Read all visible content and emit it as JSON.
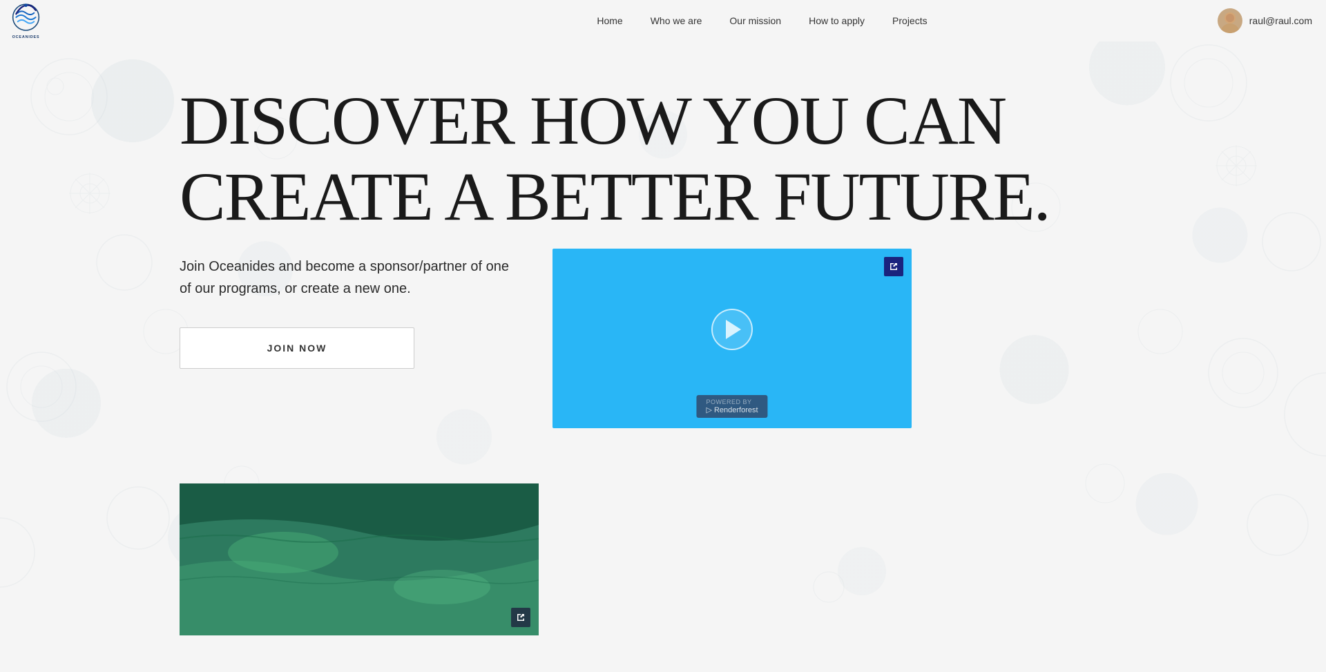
{
  "navbar": {
    "brand_name": "OCEANIDES",
    "links": [
      {
        "id": "home",
        "label": "Home"
      },
      {
        "id": "who-we-are",
        "label": "Who we are"
      },
      {
        "id": "our-mission",
        "label": "Our mission"
      },
      {
        "id": "how-to-apply",
        "label": "How to apply"
      },
      {
        "id": "projects",
        "label": "Projects"
      }
    ],
    "user_email": "raul@raul.com"
  },
  "hero": {
    "title_line1": "DISCOVER HOW YOU CAN",
    "title_line2": "CREATE A BETTER FUTURE.",
    "description": "Join Oceanides and become a sponsor/partner of one of our programs, or create a new one.",
    "join_button_label": "JOIN NOW"
  },
  "video": {
    "external_icon": "⊞",
    "powered_by_label": "POWERED BY",
    "renderforest_label": "▷ Renderforest"
  },
  "bottom_image": {
    "external_icon": "⊞"
  },
  "colors": {
    "nav_bg": "#f5f5f5",
    "hero_title": "#1a1a1a",
    "hero_desc": "#2a2a2a",
    "video_bg": "#29b6f6",
    "button_border": "#cccccc",
    "accent_blue": "#1a237e"
  }
}
